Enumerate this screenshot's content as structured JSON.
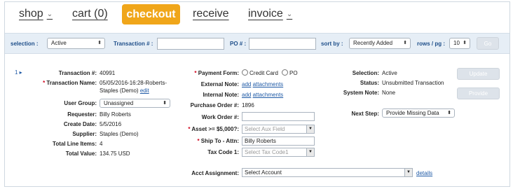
{
  "nav": {
    "shop": "shop",
    "cart": "cart (0)",
    "checkout": "checkout",
    "receive": "receive",
    "invoice": "invoice",
    "chevron_glyph": "⌄"
  },
  "filter": {
    "selection_label": "selection :",
    "selection_value": "Active",
    "transaction_label": "Transaction # :",
    "po_label": "PO # :",
    "sortby_label": "sort by :",
    "sortby_value": "Recently Added",
    "rows_label": "rows / pg :",
    "rows_value": "10",
    "go_label": "Go"
  },
  "row": {
    "index": "1 ▸",
    "transaction_no_label": "Transaction #:",
    "transaction_no": "40991",
    "transaction_name_label": "Transaction Name:",
    "transaction_name_line1": "05/05/2016-16:28-Roberts-",
    "transaction_name_line2": "Staples (Demo)",
    "edit_link": "edit",
    "user_group_label": "User Group:",
    "user_group_value": "Unassigned",
    "requester_label": "Requester:",
    "requester": "Billy Roberts",
    "create_date_label": "Create Date:",
    "create_date": "5/5/2016",
    "supplier_label": "Supplier:",
    "supplier": "Staples (Demo)",
    "total_line_items_label": "Total Line Items:",
    "total_line_items": "4",
    "total_value_label": "Total Value:",
    "total_value": "134.75 USD"
  },
  "middle": {
    "payment_form_label": "Payment Form:",
    "payment_credit": "Credit Card",
    "payment_po": "PO",
    "external_note_label": "External Note:",
    "internal_note_label": "Internal Note:",
    "add_link": "add",
    "attachments_link": "attachments",
    "po_no_label": "Purchase Order #:",
    "po_no": "1896",
    "work_order_label": "Work Order #:",
    "asset_label": "Asset >= $5,000?:",
    "asset_placeholder": "Select Aux Field",
    "ship_to_label": "Ship To - Attn:",
    "ship_to_value": "Billy Roberts",
    "tax_code_label": "Tax Code 1:",
    "tax_code_placeholder": "Select Tax Code1",
    "acct_label": "Acct Assignment:",
    "acct_value": "Select Account",
    "details_link": "details"
  },
  "right": {
    "selection_label": "Selection:",
    "selection_value": "Active",
    "status_label": "Status:",
    "status_value": "Unsubmitted Transaction",
    "system_note_label": "System Note:",
    "system_note_value": "None",
    "next_step_label": "Next Step:",
    "next_step_value": "Provide Missing Data",
    "update_label": "Update",
    "provide_label": "Provide"
  }
}
